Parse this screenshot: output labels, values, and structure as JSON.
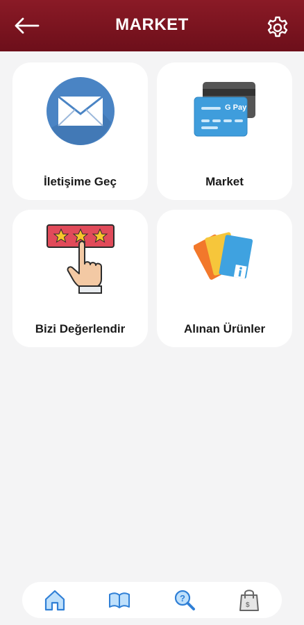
{
  "header": {
    "title": "MARKET",
    "back_icon": "back-arrow-icon",
    "settings_icon": "gear-icon",
    "background": "#7a1420"
  },
  "cards": [
    {
      "label": "İletişime Geç",
      "icon": "envelope-icon"
    },
    {
      "label": "Market",
      "icon": "payment-cards-icon"
    },
    {
      "label": "Bizi Değerlendir",
      "icon": "rating-stars-icon"
    },
    {
      "label": "Alınan Ürünler",
      "icon": "info-cards-icon"
    }
  ],
  "bottom_nav": {
    "items": [
      {
        "icon": "home-icon",
        "active": true
      },
      {
        "icon": "book-icon",
        "active": false
      },
      {
        "icon": "search-help-icon",
        "active": false
      },
      {
        "icon": "shopping-bag-icon",
        "active": false
      }
    ]
  },
  "colors": {
    "accent": "#7a1420",
    "background": "#f4f4f5",
    "card": "#ffffff",
    "nav_icon": "#3a8ee6"
  }
}
